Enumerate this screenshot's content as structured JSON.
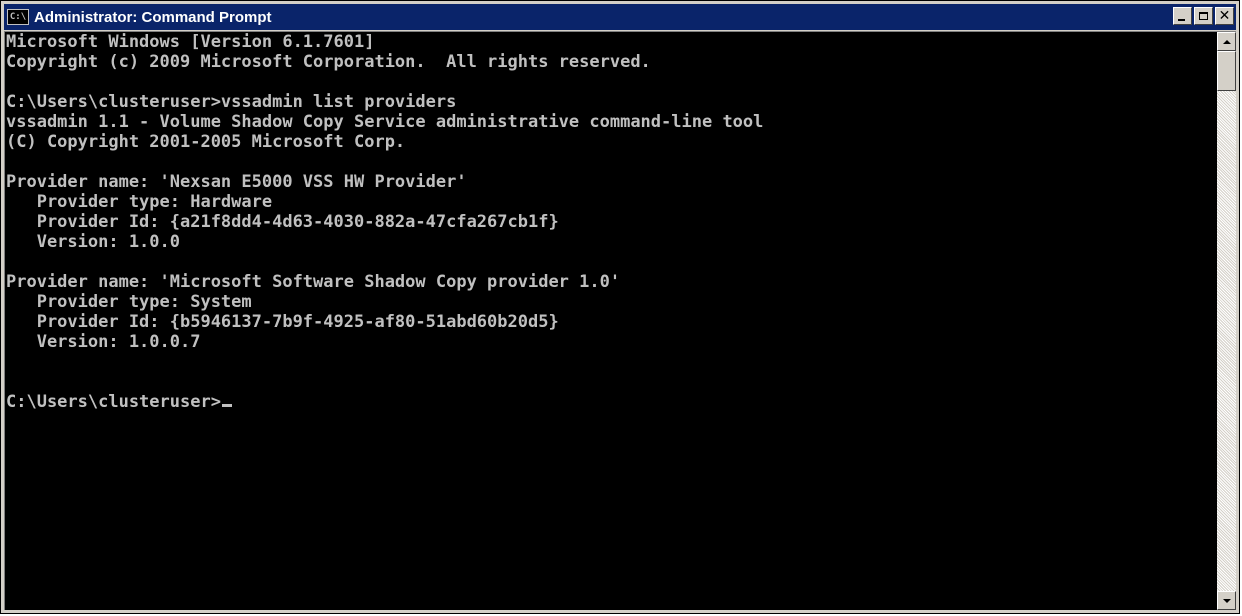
{
  "window": {
    "title": "Administrator: Command Prompt",
    "icon_text": "C:\\",
    "title_icon": "cmd-window-icon",
    "buttons": {
      "minimize_icon": "minimize-icon",
      "maximize_icon": "maximize-icon",
      "close_glyph": "✕"
    }
  },
  "console": {
    "lines": [
      "Microsoft Windows [Version 6.1.7601]",
      "Copyright (c) 2009 Microsoft Corporation.  All rights reserved.",
      "",
      "C:\\Users\\clusteruser>vssadmin list providers",
      "vssadmin 1.1 - Volume Shadow Copy Service administrative command-line tool",
      "(C) Copyright 2001-2005 Microsoft Corp.",
      "",
      "Provider name: 'Nexsan E5000 VSS HW Provider'",
      "   Provider type: Hardware",
      "   Provider Id: {a21f8dd4-4d63-4030-882a-47cfa267cb1f}",
      "   Version: 1.0.0",
      "",
      "Provider name: 'Microsoft Software Shadow Copy provider 1.0'",
      "   Provider type: System",
      "   Provider Id: {b5946137-7b9f-4925-af80-51abd60b20d5}",
      "   Version: 1.0.0.7",
      "",
      "",
      "C:\\Users\\clusteruser>"
    ]
  },
  "colors": {
    "console_background": "#000000",
    "console_text": "#c0c0c0",
    "titlebar": "#0a246a"
  }
}
